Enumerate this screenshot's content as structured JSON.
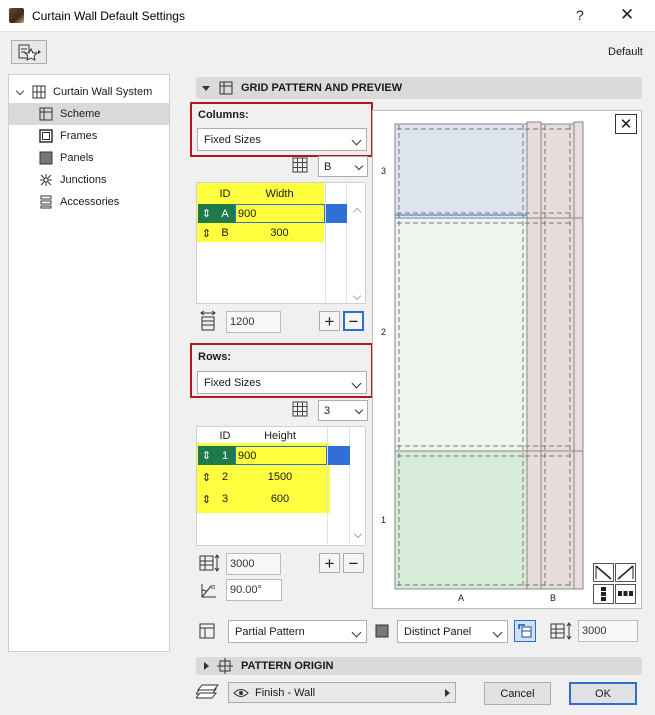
{
  "window": {
    "title": "Curtain Wall Default Settings",
    "help": "?",
    "close": "✕"
  },
  "default_label": "Default",
  "tree": {
    "root": "Curtain Wall System",
    "items": [
      {
        "label": "Scheme",
        "icon": "scheme-icon",
        "selected": true
      },
      {
        "label": "Frames",
        "icon": "frames-icon"
      },
      {
        "label": "Panels",
        "icon": "panels-icon"
      },
      {
        "label": "Junctions",
        "icon": "junctions-icon"
      },
      {
        "label": "Accessories",
        "icon": "accessories-icon"
      }
    ]
  },
  "grid_section": {
    "title": "GRID PATTERN AND PREVIEW"
  },
  "columns": {
    "label": "Columns:",
    "mode": "Fixed Sizes",
    "pattern_value": "B",
    "table": {
      "headers": [
        "ID",
        "Width"
      ],
      "rows": [
        {
          "id": "A",
          "value": "900"
        },
        {
          "id": "B",
          "value": "300"
        }
      ]
    },
    "total": "1200"
  },
  "rows": {
    "label": "Rows:",
    "mode": "Fixed Sizes",
    "pattern_value": "3",
    "table": {
      "headers": [
        "ID",
        "Height"
      ],
      "rows": [
        {
          "id": "1",
          "value": "900"
        },
        {
          "id": "2",
          "value": "1500"
        },
        {
          "id": "3",
          "value": "600"
        }
      ]
    },
    "total": "3000",
    "angle": "90.00°"
  },
  "preview": {
    "row_labels": [
      "3",
      "2",
      "1"
    ],
    "col_labels": [
      "A",
      "B"
    ],
    "colors": {
      "panel_blue": "#dde4ee",
      "panel_light": "#edf5ee",
      "panel_green": "#d6ecd8",
      "panel_pink": "#e7dddd"
    }
  },
  "pattern_bar": {
    "pattern_mode": "Partial Pattern",
    "panel_mode": "Distinct Panel",
    "height": "3000"
  },
  "origin_section": {
    "title": "PATTERN ORIGIN"
  },
  "footer": {
    "layer": "Finish - Wall",
    "cancel": "Cancel",
    "ok": "OK"
  }
}
